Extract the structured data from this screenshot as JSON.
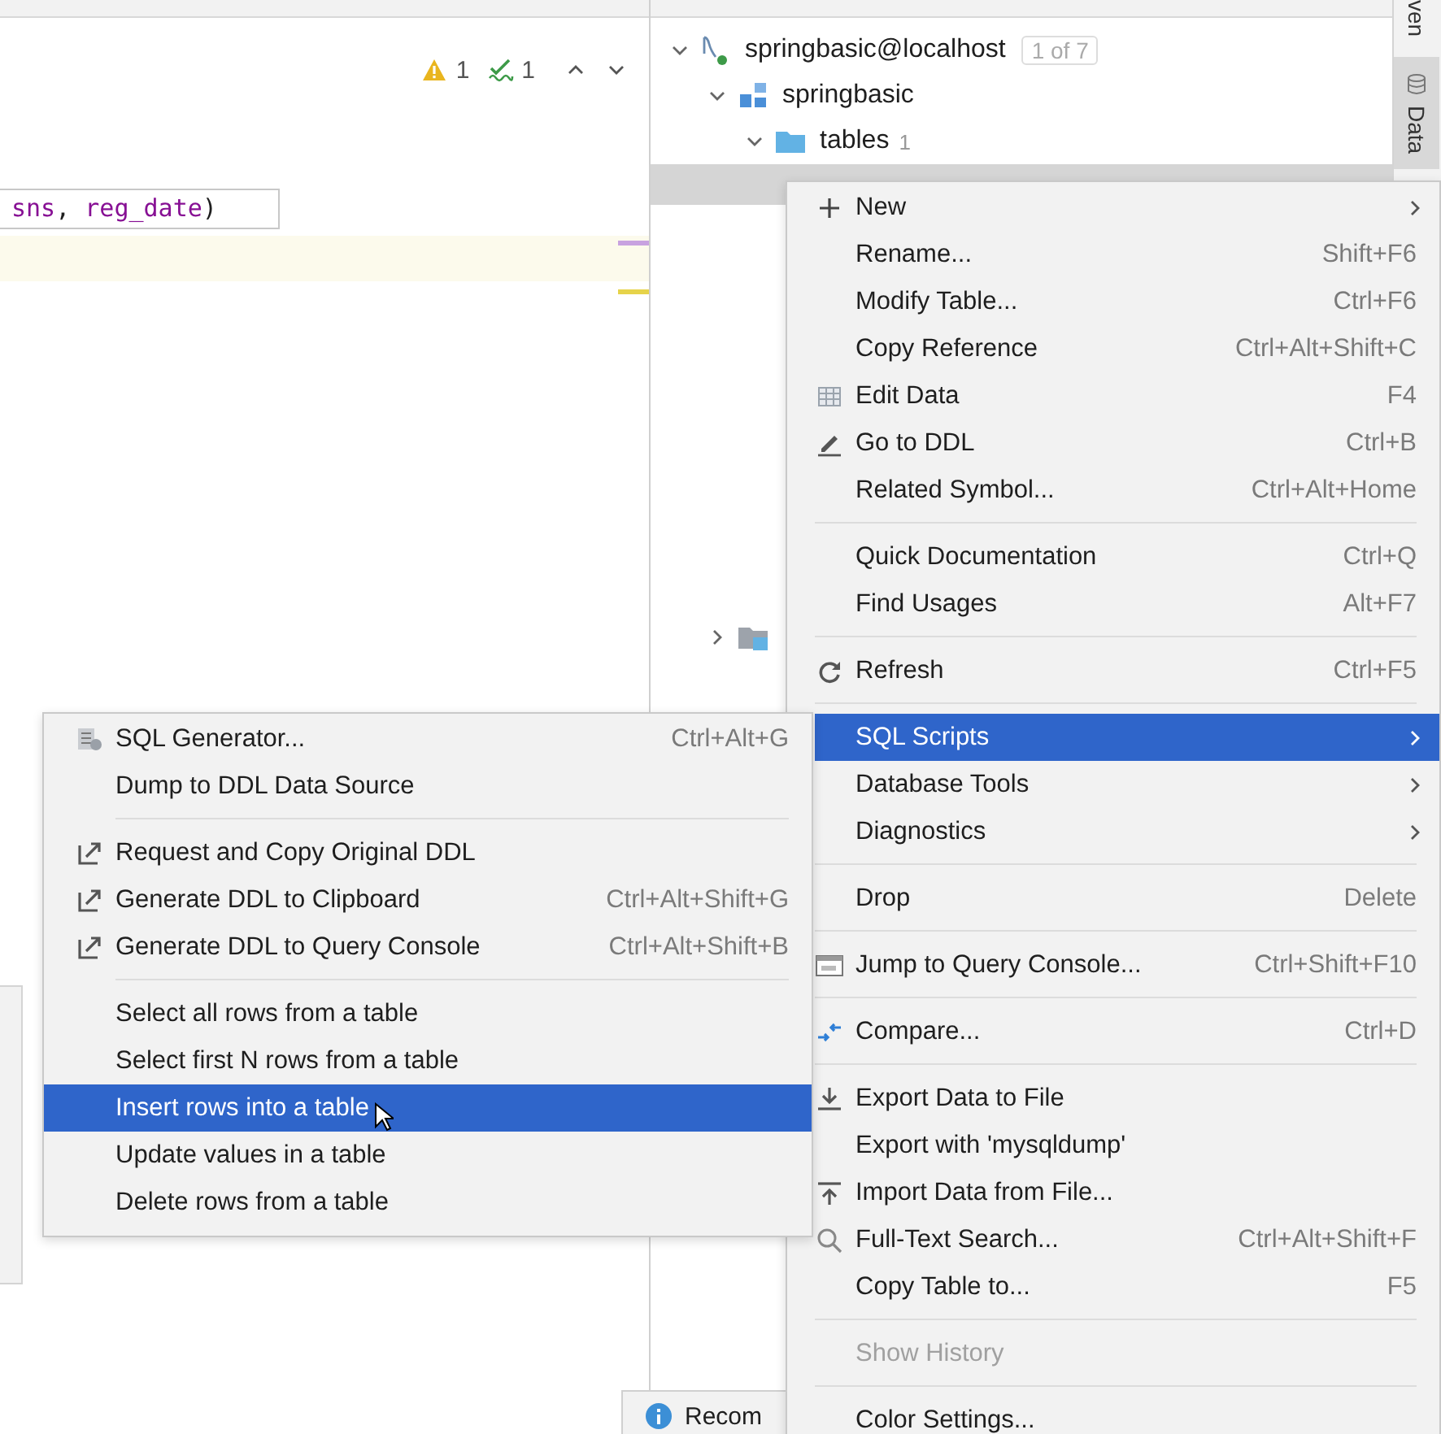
{
  "editor": {
    "inspections": [
      {
        "kind": "warning",
        "count": "1"
      },
      {
        "kind": "typo",
        "count": "1"
      }
    ],
    "code_line": [
      {
        "text": "sns",
        "kind": "identifier"
      },
      {
        "text": ", ",
        "kind": "punct"
      },
      {
        "text": "reg_date",
        "kind": "identifier"
      },
      {
        "text": ")",
        "kind": "punct"
      }
    ]
  },
  "database_tree": [
    {
      "label": "springbasic@localhost",
      "badge": "1 of 7",
      "kind": "datasource",
      "expanded": true,
      "selected": false,
      "children": [
        {
          "label": "springbasic",
          "kind": "schema",
          "expanded": true,
          "selected": false,
          "children": [
            {
              "label": "tables",
              "count": "1",
              "kind": "folder",
              "expanded": true,
              "selected": false,
              "children": [
                {
                  "selected": true
                }
              ]
            }
          ]
        },
        {
          "kind": "objects",
          "expanded": false,
          "selected": false
        }
      ]
    }
  ],
  "side_strip": [
    {
      "label": "ven",
      "selected": false
    },
    {
      "label": "Data",
      "selected": true
    }
  ],
  "context_menu": {
    "items": [
      {
        "kind": "plus",
        "label": "New",
        "submenu": true,
        "selected": false,
        "disabled": false
      },
      {
        "kind": "plain",
        "label": "Rename...",
        "shortcut": "Shift+F6",
        "submenu": false,
        "selected": false,
        "disabled": false
      },
      {
        "kind": "plain",
        "label": "Modify Table...",
        "shortcut": "Ctrl+F6",
        "submenu": false,
        "selected": false,
        "disabled": false
      },
      {
        "kind": "plain",
        "label": "Copy Reference",
        "shortcut": "Ctrl+Alt+Shift+C",
        "submenu": false,
        "selected": false,
        "disabled": false
      },
      {
        "kind": "grid",
        "label": "Edit Data",
        "shortcut": "F4",
        "submenu": false,
        "selected": false,
        "disabled": false
      },
      {
        "kind": "pencil",
        "label": "Go to DDL",
        "shortcut": "Ctrl+B",
        "submenu": false,
        "selected": false,
        "disabled": false
      },
      {
        "kind": "plain",
        "label": "Related Symbol...",
        "shortcut": "Ctrl+Alt+Home",
        "submenu": false,
        "selected": false,
        "disabled": false
      },
      {
        "kind": "separator"
      },
      {
        "kind": "plain",
        "label": "Quick Documentation",
        "shortcut": "Ctrl+Q",
        "submenu": false,
        "selected": false,
        "disabled": false
      },
      {
        "kind": "plain",
        "label": "Find Usages",
        "shortcut": "Alt+F7",
        "submenu": false,
        "selected": false,
        "disabled": false
      },
      {
        "kind": "separator"
      },
      {
        "kind": "refresh",
        "label": "Refresh",
        "shortcut": "Ctrl+F5",
        "submenu": false,
        "selected": false,
        "disabled": false
      },
      {
        "kind": "separator"
      },
      {
        "kind": "plain",
        "label": "SQL Scripts",
        "submenu": true,
        "selected": true,
        "disabled": false
      },
      {
        "kind": "plain",
        "label": "Database Tools",
        "submenu": true,
        "selected": false,
        "disabled": false
      },
      {
        "kind": "plain",
        "label": "Diagnostics",
        "submenu": true,
        "selected": false,
        "disabled": false
      },
      {
        "kind": "separator"
      },
      {
        "kind": "plain",
        "label": "Drop",
        "shortcut": "Delete",
        "submenu": false,
        "selected": false,
        "disabled": false
      },
      {
        "kind": "separator"
      },
      {
        "kind": "console",
        "label": "Jump to Query Console...",
        "shortcut": "Ctrl+Shift+F10",
        "submenu": false,
        "selected": false,
        "disabled": false
      },
      {
        "kind": "separator"
      },
      {
        "kind": "compare",
        "label": "Compare...",
        "shortcut": "Ctrl+D",
        "submenu": false,
        "selected": false,
        "disabled": false
      },
      {
        "kind": "separator"
      },
      {
        "kind": "download",
        "label": "Export Data to File",
        "submenu": false,
        "selected": false,
        "disabled": false
      },
      {
        "kind": "plain",
        "label": "Export with 'mysqldump'",
        "submenu": false,
        "selected": false,
        "disabled": false
      },
      {
        "kind": "upload",
        "label": "Import Data from File...",
        "submenu": false,
        "selected": false,
        "disabled": false
      },
      {
        "kind": "search",
        "label": "Full-Text Search...",
        "shortcut": "Ctrl+Alt+Shift+F",
        "submenu": false,
        "selected": false,
        "disabled": false
      },
      {
        "kind": "plain",
        "label": "Copy Table to...",
        "shortcut": "F5",
        "submenu": false,
        "selected": false,
        "disabled": false
      },
      {
        "kind": "separator"
      },
      {
        "kind": "plain",
        "label": "Show History",
        "submenu": false,
        "selected": false,
        "disabled": true
      },
      {
        "kind": "separator"
      },
      {
        "kind": "plain",
        "label": "Color Settings...",
        "submenu": false,
        "selected": false,
        "disabled": false
      }
    ]
  },
  "submenu": {
    "items": [
      {
        "kind": "generator",
        "label": "SQL Generator...",
        "shortcut": "Ctrl+Alt+G",
        "selected": false
      },
      {
        "kind": "plain",
        "label": "Dump to DDL Data Source",
        "selected": false
      },
      {
        "kind": "separator"
      },
      {
        "kind": "ddl",
        "label": "Request and Copy Original DDL",
        "selected": false
      },
      {
        "kind": "ddl",
        "label": "Generate DDL to Clipboard",
        "shortcut": "Ctrl+Alt+Shift+G",
        "selected": false
      },
      {
        "kind": "ddl",
        "label": "Generate DDL to Query Console",
        "shortcut": "Ctrl+Alt+Shift+B",
        "selected": false
      },
      {
        "kind": "separator"
      },
      {
        "kind": "plain",
        "label": "Select all rows from a table",
        "selected": false
      },
      {
        "kind": "plain",
        "label": "Select first N rows from a table",
        "selected": false
      },
      {
        "kind": "plain",
        "label": "Insert rows into a table",
        "selected": true
      },
      {
        "kind": "plain",
        "label": "Update values in a table",
        "selected": false
      },
      {
        "kind": "plain",
        "label": "Delete rows from a table",
        "selected": false
      }
    ]
  },
  "notification": {
    "kind": "info",
    "text": "Recom"
  }
}
